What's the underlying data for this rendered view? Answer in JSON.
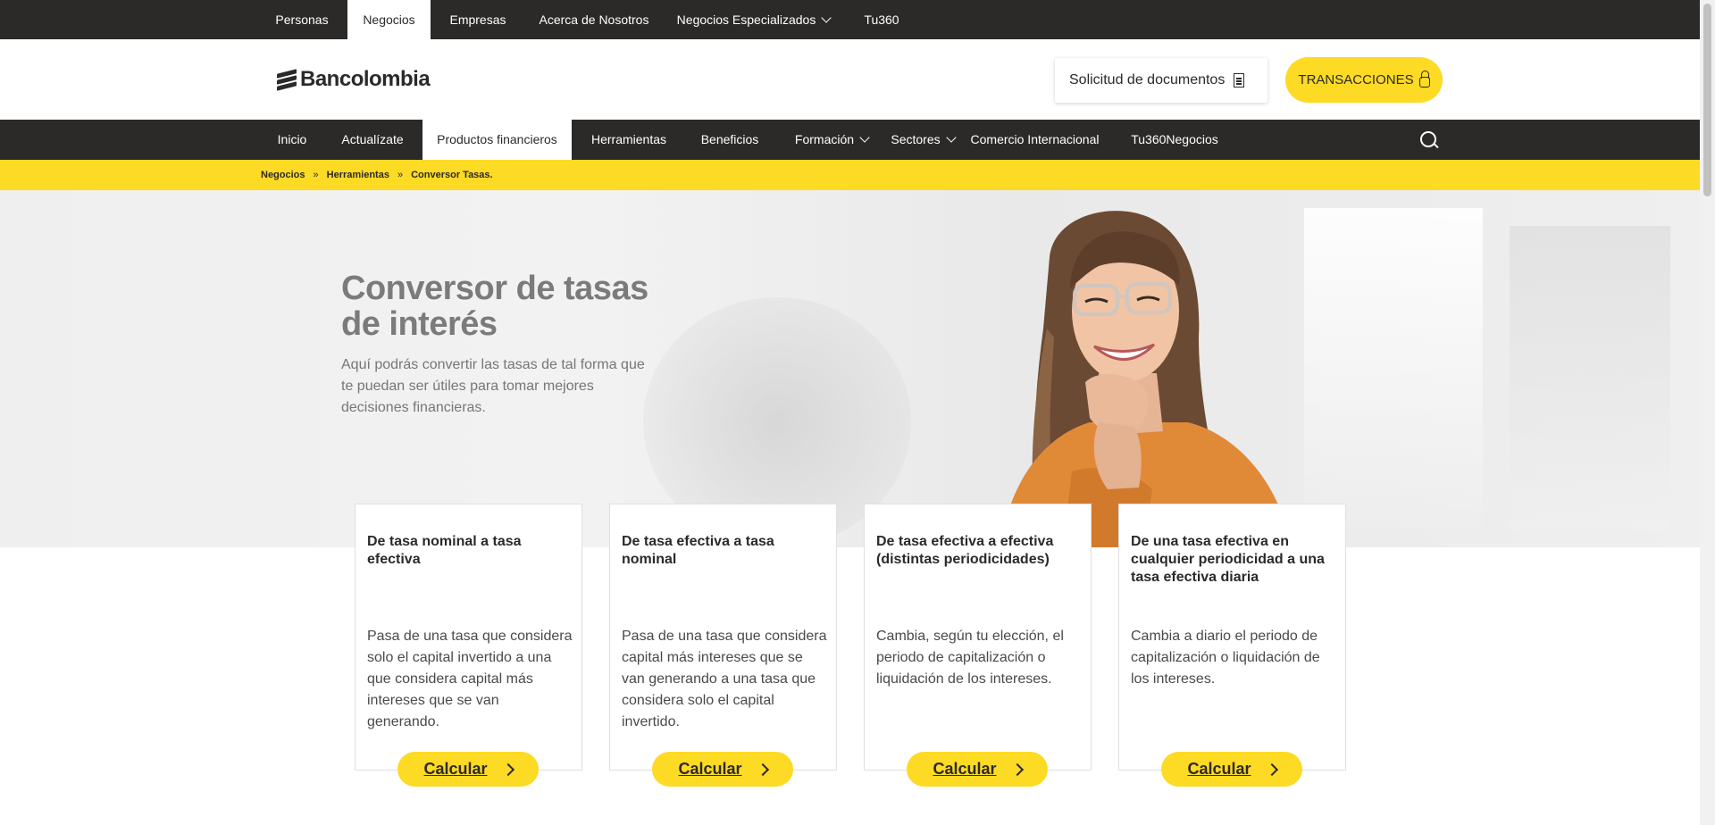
{
  "top_nav": {
    "items": [
      {
        "label": "Personas"
      },
      {
        "label": "Negocios",
        "active": true
      },
      {
        "label": "Empresas"
      },
      {
        "label": "Acerca de Nosotros"
      },
      {
        "label": "Negocios Especializados",
        "icon": "chevron-down-icon"
      },
      {
        "label": "Tu360"
      }
    ]
  },
  "header": {
    "logo_text": "Bancolombia",
    "documents_button": {
      "label": "Solicitud de documentos",
      "icon": "document-icon"
    },
    "transactions_button": {
      "label": "TRANSACCIONES",
      "icon": "lock-icon"
    }
  },
  "main_nav": {
    "items": [
      {
        "label": "Inicio"
      },
      {
        "label": "Actualízate"
      },
      {
        "label": "Productos financieros",
        "active": true
      },
      {
        "label": "Herramientas"
      },
      {
        "label": "Beneficios"
      },
      {
        "label": "Formación",
        "icon": "chevron-down-icon"
      },
      {
        "label": "Sectores",
        "icon": "chevron-down-icon"
      },
      {
        "label": "Comercio Internacional"
      },
      {
        "label": "Tu360Negocios"
      }
    ],
    "search_icon": "search-icon"
  },
  "breadcrumb": {
    "items": [
      "Negocios",
      "Herramientas",
      "Conversor Tasas."
    ],
    "separator": "»"
  },
  "hero": {
    "title": "Conversor de tasas de interés",
    "description": "Aquí podrás convertir las tasas de tal forma que te puedan ser útiles para tomar mejores decisiones financieras."
  },
  "cards": [
    {
      "title": "De tasa nominal a tasa efectiva",
      "description": "Pasa de una tasa que considera solo el capital invertido a una que considera capital más intereses que se van generando.",
      "button": "Calcular"
    },
    {
      "title": "De tasa efectiva a tasa nominal",
      "description": "Pasa de una tasa que considera capital más intereses que se van generando a una tasa que considera solo el capital invertido.",
      "button": "Calcular"
    },
    {
      "title": "De tasa efectiva a efectiva (distintas periodicidades)",
      "description": "Cambia, según tu elección, el periodo de capitalización o liquidación de los intereses.",
      "button": "Calcular"
    },
    {
      "title": "De una tasa efectiva en cualquier periodicidad a una tasa efectiva diaria",
      "description": "Cambia a diario el periodo de capitalización o liquidación de los intereses.",
      "button": "Calcular"
    }
  ],
  "colors": {
    "brand_yellow": "#fdda24",
    "dark": "#2c2a29"
  }
}
